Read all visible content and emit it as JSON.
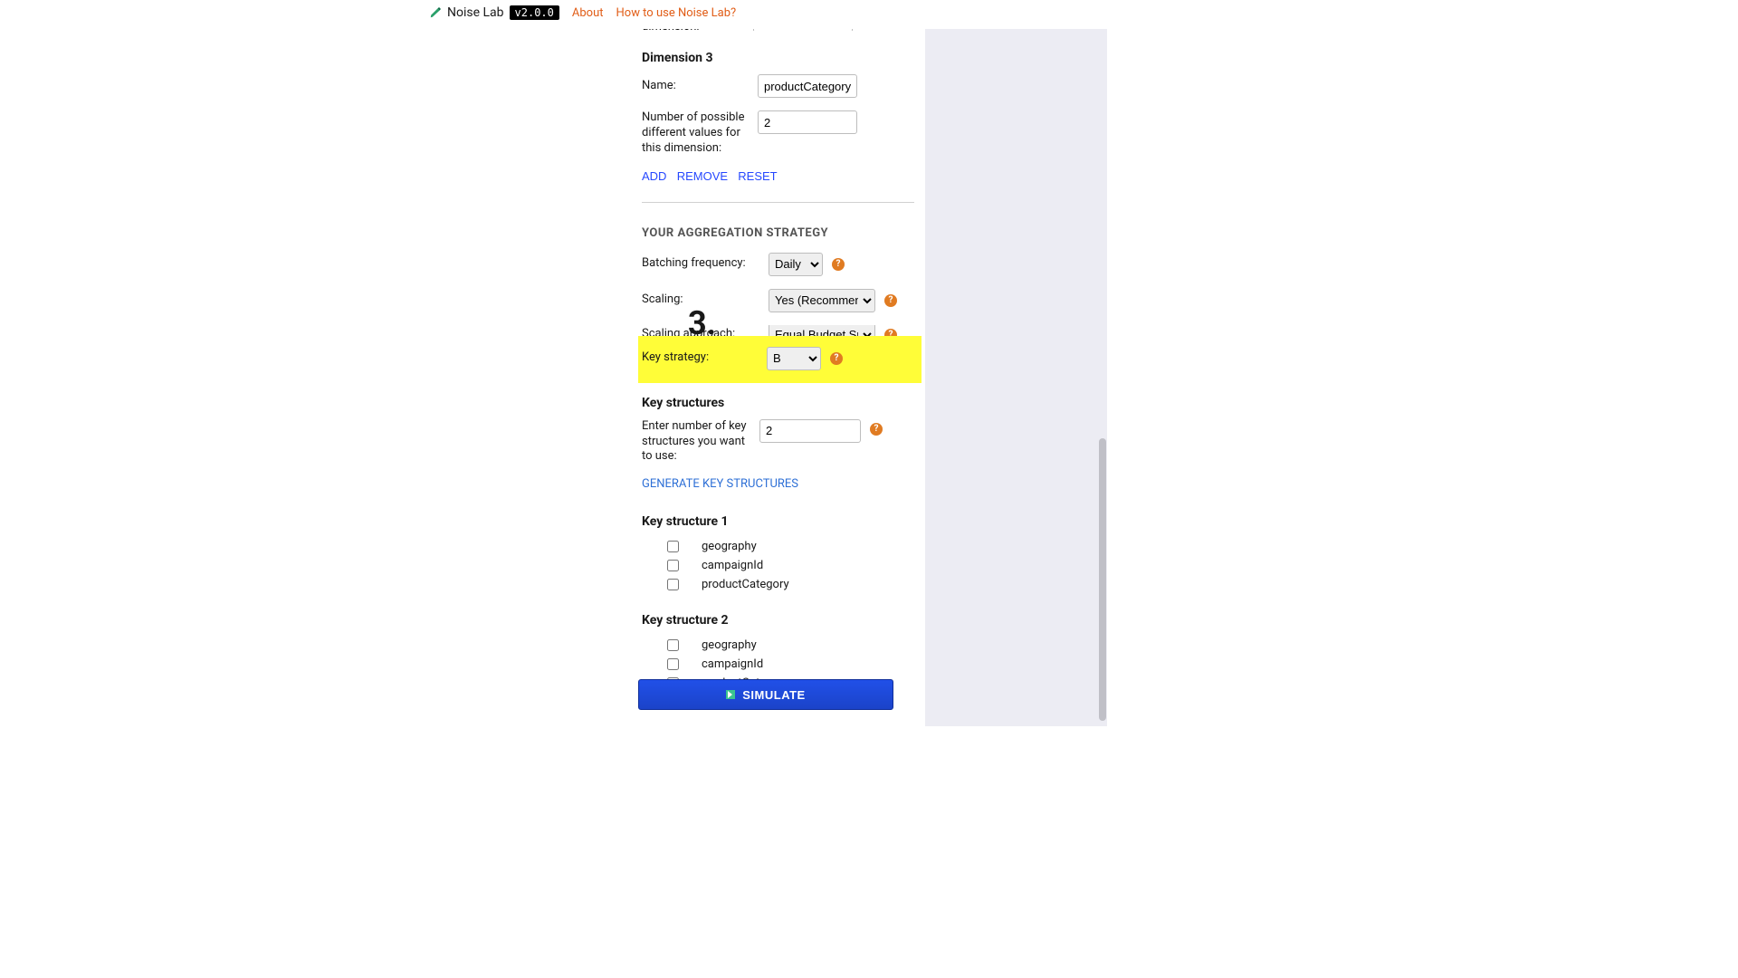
{
  "header": {
    "title": "Noise Lab",
    "version": "v2.0.0",
    "nav_about": "About",
    "nav_howto": "How to use Noise Lab?"
  },
  "cutoff_label": "dimension:",
  "dimension3": {
    "heading": "Dimension 3",
    "name_label": "Name:",
    "name_value": "productCategory",
    "count_label": "Number of possible different values for this dimension:",
    "count_value": "2"
  },
  "actions": {
    "add": "ADD",
    "remove": "REMOVE",
    "reset": "RESET"
  },
  "strategy": {
    "heading": "YOUR AGGREGATION STRATEGY",
    "batching_label": "Batching frequency:",
    "batching_value": "Daily",
    "scaling_label": "Scaling:",
    "scaling_value": "Yes (Recommended)",
    "scaling_approach_label": "Scaling approach:",
    "scaling_approach_value": "Equal Budget Split",
    "key_strategy_label": "Key strategy:",
    "key_strategy_value": "B"
  },
  "key_structures": {
    "heading": "Key structures",
    "count_label": "Enter number of key structures you want to use:",
    "count_value": "2",
    "generate": "GENERATE KEY STRUCTURES",
    "ks1_heading": "Key structure 1",
    "ks2_heading": "Key structure 2",
    "opts": [
      "geography",
      "campaignId",
      "productCategory"
    ]
  },
  "simulate": "SIMULATE",
  "annotation": "3."
}
